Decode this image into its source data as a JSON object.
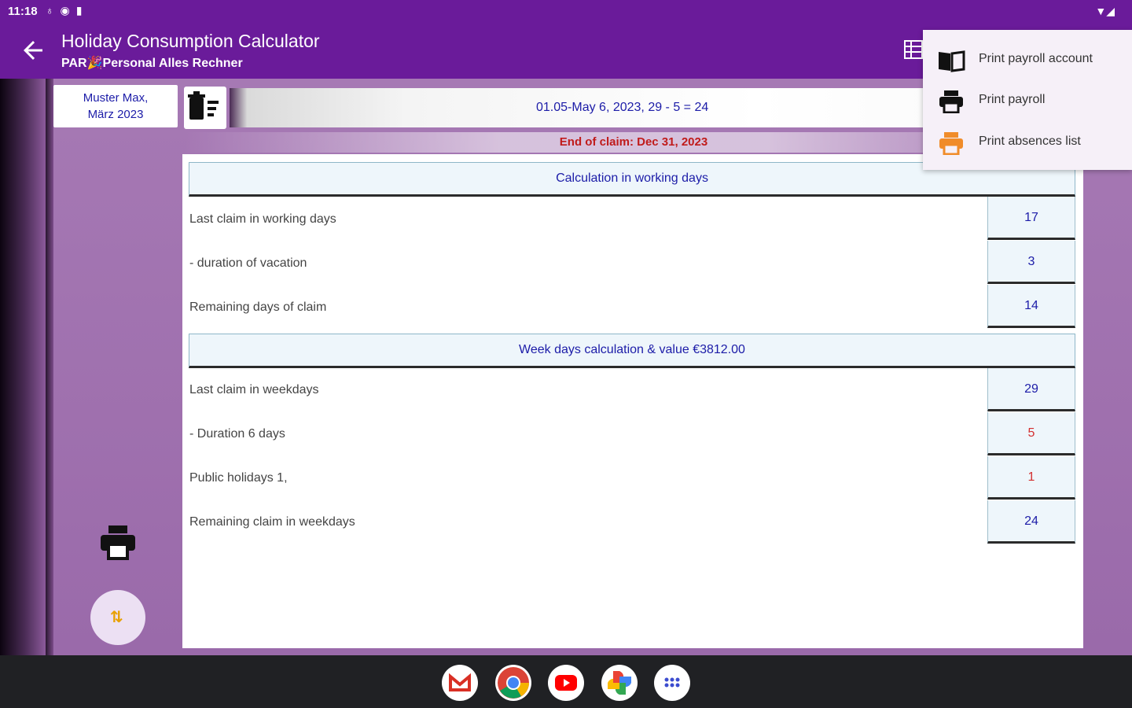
{
  "status_bar": {
    "time": "11:18",
    "icons": [
      "sync-icon",
      "app-icon",
      "clipboard-icon"
    ],
    "right_icons": [
      "wifi-icon",
      "signal-icon",
      "battery-icon"
    ]
  },
  "app_bar": {
    "title": "Holiday Consumption Calculator",
    "subtitle": "PAR🎉Personal Alles Rechner"
  },
  "employee": {
    "line1": "Muster Max,",
    "line2": "März 2023"
  },
  "date_summary": "01.05-May 6, 2023, 29 - 5 = 24",
  "end_of_claim": "End of claim: Dec 31, 2023",
  "working_days": {
    "header": "Calculation in working days",
    "rows": [
      {
        "label": "Last claim in working days",
        "value": "17"
      },
      {
        "label": "- duration of vacation",
        "value": "3"
      },
      {
        "label": "Remaining days of claim",
        "value": "14"
      }
    ]
  },
  "week_days": {
    "header": "Week days calculation & value €3812.00",
    "rows": [
      {
        "label": "Last claim in weekdays",
        "value": "29"
      },
      {
        "label": "- Duration 6 days",
        "value": "5"
      },
      {
        "label": "Public holidays 1,",
        "value": "1"
      },
      {
        "label": "Remaining claim in weekdays",
        "value": "24"
      }
    ]
  },
  "menu": {
    "items": [
      {
        "label": "Print payroll account",
        "icon": "book-icon"
      },
      {
        "label": "Print payroll",
        "icon": "printer-icon"
      },
      {
        "label": "Print absences list",
        "icon": "printer-orange-icon"
      }
    ]
  },
  "colors": {
    "primary": "#6a1b9a",
    "accent_text": "#1c1ca8",
    "alert": "#c01b1b",
    "menu_orange": "#f08c2a"
  },
  "dock": [
    "gmail-icon",
    "chrome-icon",
    "youtube-icon",
    "photos-icon",
    "app-launcher-icon"
  ]
}
